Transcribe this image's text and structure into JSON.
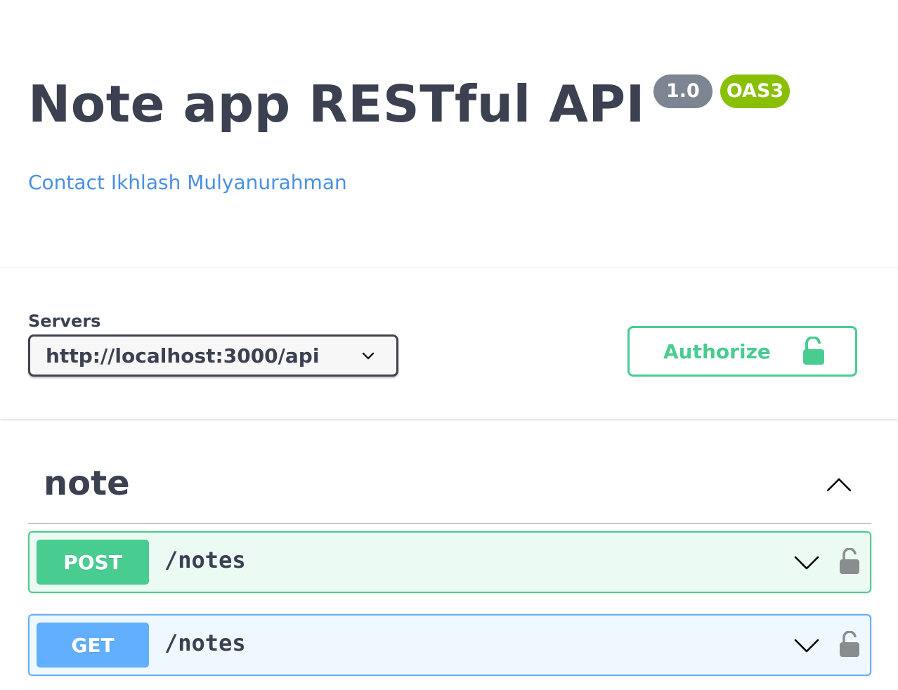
{
  "info": {
    "title": "Note app RESTful API",
    "version_badge": "1.0",
    "oas_badge": "OAS3",
    "contact_link": "Contact Ikhlash Mulyanurahman"
  },
  "servers": {
    "label": "Servers",
    "selected": "http://localhost:3000/api"
  },
  "authorize": {
    "label": "Authorize",
    "icon": "unlocked-lock-icon"
  },
  "tag": {
    "name": "note",
    "expanded": true
  },
  "operations": [
    {
      "method": "POST",
      "path": "/notes"
    },
    {
      "method": "GET",
      "path": "/notes"
    }
  ],
  "colors": {
    "text": "#3b4151",
    "link": "#4990e2",
    "version_badge": "#7d8492",
    "oas_badge": "#89bf04",
    "post": "#49cc90",
    "get": "#61affe",
    "lock_gray": "#8a8d8e"
  }
}
